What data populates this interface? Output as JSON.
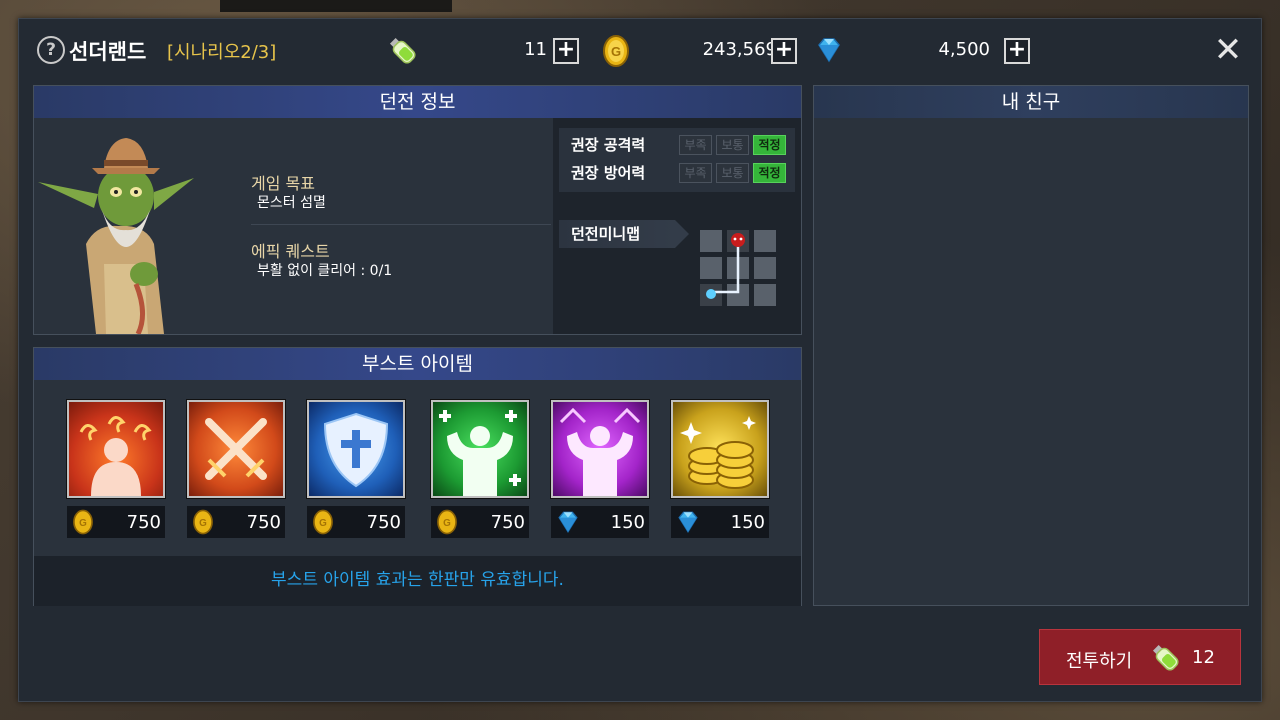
{
  "header": {
    "help_icon": "question-mark",
    "title": "선더랜드",
    "scenario": "[시나리오2/3]",
    "stamina": "11",
    "gold": "243,569",
    "gems": "4,500"
  },
  "dungeon": {
    "heading": "던전 정보",
    "goal_label": "게임 목표",
    "goal_value": "몬스터 섬멸",
    "epic_label": "에픽 퀘스트",
    "epic_value": "부활 없이 클리어 : 0/1",
    "rec_attack": "권장 공격력",
    "rec_defense": "권장 방어력",
    "tags": [
      "부족",
      "보통",
      "적정"
    ],
    "active_tag": "적정",
    "minimap_label": "던전미니맵"
  },
  "friends": {
    "heading": "내 친구"
  },
  "boost": {
    "heading": "부스트 아이템",
    "items": [
      {
        "icon": "rage-icon",
        "currency": "gold",
        "price": "750",
        "color": "#c9341a"
      },
      {
        "icon": "swords-icon",
        "currency": "gold",
        "price": "750",
        "color": "#d24a1a"
      },
      {
        "icon": "shield-icon",
        "currency": "gold",
        "price": "750",
        "color": "#1f5fb8"
      },
      {
        "icon": "muscle-plus-icon",
        "currency": "gold",
        "price": "750",
        "color": "#1c9a32"
      },
      {
        "icon": "muscle-purple-icon",
        "currency": "gem",
        "price": "150",
        "color": "#a324c9"
      },
      {
        "icon": "coins-icon",
        "currency": "gem",
        "price": "150",
        "color": "#c9a21c"
      }
    ],
    "note": "부스트 아이템 효과는 한판만 유효합니다."
  },
  "battle": {
    "label": "전투하기",
    "cost": "12"
  }
}
